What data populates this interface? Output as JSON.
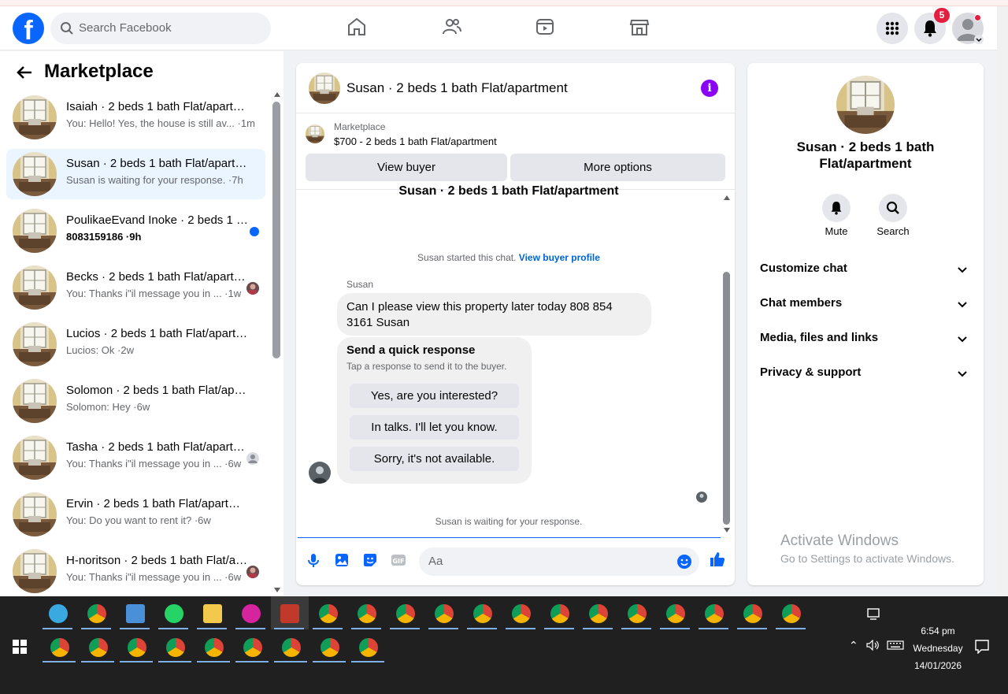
{
  "brand": {
    "logo_letter": "f"
  },
  "search": {
    "placeholder": "Search Facebook"
  },
  "nav": {
    "icons": [
      "home-icon",
      "friends-icon",
      "watch-icon",
      "marketplace-icon"
    ]
  },
  "header_right": {
    "notifications_count": "5"
  },
  "sidebar": {
    "title": "Marketplace",
    "conversations": [
      {
        "name": "Isaiah · 2 beds 1 bath Flat/apartment",
        "preview": "You: Hello! Yes, the house is still av... ·1m",
        "active": false,
        "unread": false,
        "indicator": "none"
      },
      {
        "name": "Susan · 2 beds 1 bath Flat/apartment",
        "preview": "Susan is waiting for your response. ·7h",
        "active": true,
        "unread": false,
        "indicator": "none"
      },
      {
        "name": "PoulikaeEvand Inoke · 2 beds 1 bath Flat/apartment",
        "preview": "8083159186 ·9h",
        "active": false,
        "unread": true,
        "indicator": "dot"
      },
      {
        "name": "Becks · 2 beds 1 bath Flat/apartment",
        "preview": "You: Thanks i\"il message you in ... ·1w",
        "active": false,
        "unread": false,
        "indicator": "avatar"
      },
      {
        "name": "Lucios · 2 beds 1 bath Flat/apartment",
        "preview": "Lucios: Ok ·2w",
        "active": false,
        "unread": false,
        "indicator": "none"
      },
      {
        "name": "Solomon · 2 beds 1 bath Flat/apartment",
        "preview": "Solomon: Hey ·6w",
        "active": false,
        "unread": false,
        "indicator": "none"
      },
      {
        "name": "Tasha · 2 beds 1 bath Flat/apartment",
        "preview": "You: Thanks i\"il message you in ... ·6w",
        "active": false,
        "unread": false,
        "indicator": "default-avatar"
      },
      {
        "name": "Ervin · 2 beds 1 bath Flat/apartment",
        "preview": "You: Do you want to rent it? ·6w",
        "active": false,
        "unread": false,
        "indicator": "none"
      },
      {
        "name": "H-noritson · 2 beds 1 bath Flat/apartment",
        "preview": "You: Thanks i\"il message you in ... ·6w",
        "active": false,
        "unread": false,
        "indicator": "avatar"
      }
    ]
  },
  "chat": {
    "title": "Susan · 2 beds 1 bath Flat/apartment",
    "listing": {
      "label": "Marketplace",
      "price_title": "$700 - 2 beds 1 bath Flat/apartment",
      "view_buyer": "View buyer",
      "more_options": "More options"
    },
    "cut_title": "Susan · 2 beds 1 bath Flat/apartment",
    "started_text": "Susan started this chat.",
    "view_buyer_profile": "View buyer profile",
    "sender": "Susan",
    "message": "Can I please view this property later today 808 854 3161 Susan",
    "quick_response": {
      "title": "Send a quick response",
      "subtitle": "Tap a response to send it to the buyer.",
      "options": [
        "Yes, are you interested?",
        "In talks. I'll let you know.",
        "Sorry, it's not available."
      ]
    },
    "waiting_text": "Susan is waiting for your response.",
    "composer_placeholder": "Aa"
  },
  "details": {
    "name": "Susan · 2 beds 1 bath Flat/apartment",
    "actions": [
      {
        "label": "Mute",
        "icon": "bell-icon"
      },
      {
        "label": "Search",
        "icon": "search-icon"
      }
    ],
    "sections": [
      "Customize chat",
      "Chat members",
      "Media, files and links",
      "Privacy & support"
    ]
  },
  "watermark": {
    "line1": "Activate Windows",
    "line2": "Go to Settings to activate Windows."
  },
  "taskbar": {
    "time": "6:54 pm",
    "day": "Wednesday",
    "date": "14/01/2026"
  },
  "colors": {
    "brand": "#0866ff",
    "info": "#8a05f5",
    "badge": "#e41e3f"
  }
}
